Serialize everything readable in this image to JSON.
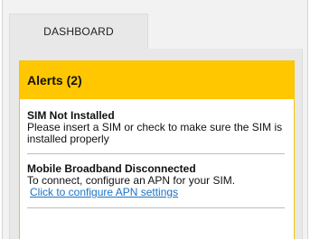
{
  "tabs": [
    {
      "label": "DASHBOARD"
    }
  ],
  "alerts_panel": {
    "title": "Alerts (2)",
    "header_color": "#ffc700",
    "alerts": [
      {
        "title": "SIM Not Installed",
        "message": "Please insert a SIM or check to make sure the SIM is installed properly"
      },
      {
        "title": "Mobile Broadband Disconnected",
        "message": "To connect, configure an APN for your SIM.",
        "link": "Click to configure APN settings"
      }
    ]
  }
}
